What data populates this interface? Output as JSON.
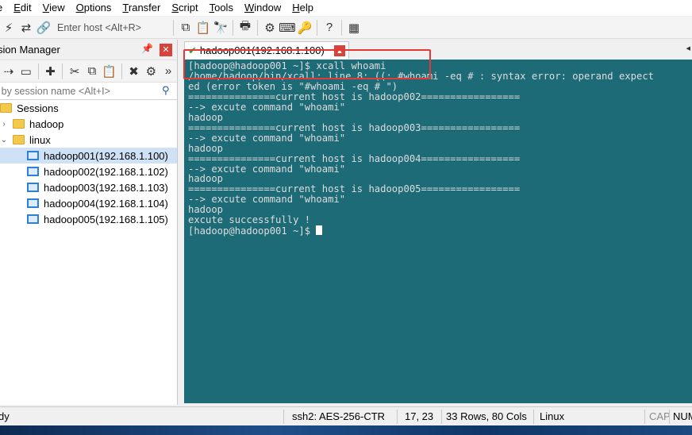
{
  "menu": [
    "e",
    "Edit",
    "View",
    "Options",
    "Transfer",
    "Script",
    "Tools",
    "Window",
    "Help"
  ],
  "toolbar": {
    "quick_connect_placeholder": "Enter host <Alt+R>",
    "icons": [
      "lightning-icon",
      "reconnect-icon",
      "link-icon",
      "copy-icon",
      "paste-icon",
      "find-icon",
      "print-icon",
      "settings-icon",
      "keymap-icon",
      "key-icon",
      "help-icon",
      "sftp-icon"
    ]
  },
  "session_manager": {
    "title": "sion Manager",
    "filter_placeholder": "r by session name <Alt+I>",
    "tree": [
      {
        "label": "Sessions",
        "level": 0,
        "type": "folder"
      },
      {
        "label": "hadoop",
        "level": 1,
        "type": "folder",
        "expander": "›"
      },
      {
        "label": "linux",
        "level": 1,
        "type": "folder",
        "expander": "⌄"
      },
      {
        "label": "hadoop001(192.168.1.100)",
        "level": 2,
        "type": "session",
        "selected": true
      },
      {
        "label": "hadoop002(192.168.1.102)",
        "level": 2,
        "type": "session"
      },
      {
        "label": "hadoop003(192.168.1.103)",
        "level": 2,
        "type": "session"
      },
      {
        "label": "hadoop004(192.168.1.104)",
        "level": 2,
        "type": "session"
      },
      {
        "label": "hadoop005(192.168.1.105)",
        "level": 2,
        "type": "session"
      }
    ]
  },
  "tab": {
    "label": "hadoop001(192.168.1.100)"
  },
  "terminal": {
    "lines": [
      "[hadoop@hadoop001 ~]$ xcall whoami",
      "/home/hadoop/bin/xcall: line 8: ((: #whoami -eq # : syntax error: operand expect",
      "ed (error token is \"#whoami -eq # \")",
      "===============current host is hadoop002=================",
      "--> excute command \"whoami\"",
      "hadoop",
      "===============current host is hadoop003=================",
      "--> excute command \"whoami\"",
      "hadoop",
      "===============current host is hadoop004=================",
      "--> excute command \"whoami\"",
      "hadoop",
      "===============current host is hadoop005=================",
      "--> excute command \"whoami\"",
      "hadoop",
      "excute successfully !"
    ],
    "prompt": "[hadoop@hadoop001 ~]$ "
  },
  "status": {
    "ready": "dy",
    "cipher": "ssh2: AES-256-CTR",
    "cursor_pos": "17,  23",
    "size": "33 Rows, 80 Cols",
    "term_type": "Linux",
    "caps": "CAP",
    "num": "NUM"
  }
}
